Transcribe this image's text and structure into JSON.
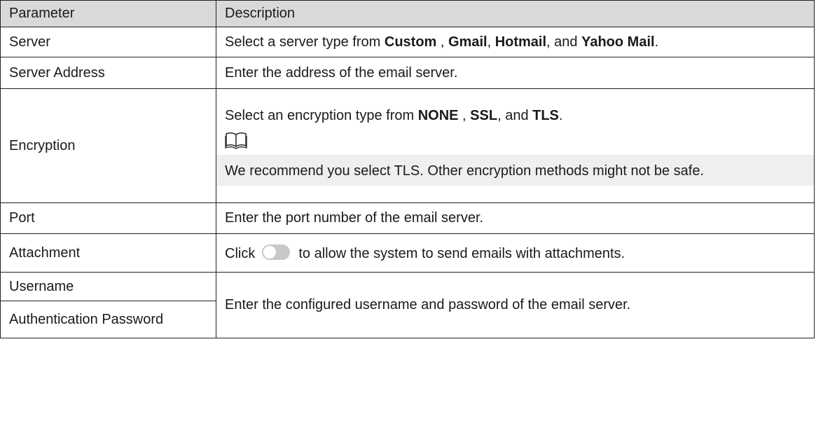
{
  "table": {
    "headers": [
      "Parameter",
      "Description"
    ],
    "server": {
      "param": "Server",
      "desc_prefix": "Select a server type from ",
      "opt1": "Custom",
      "sep1": " , ",
      "opt2": "Gmail",
      "sep2": ", ",
      "opt3": "Hotmail",
      "sep3": ", and ",
      "opt4": "Yahoo Mail",
      "end": "."
    },
    "server_address": {
      "param": "Server Address",
      "desc": "Enter the address of the email server."
    },
    "encryption": {
      "param": "Encryption",
      "desc_prefix": "Select an encryption type from ",
      "opt1": "NONE",
      "sep1": " , ",
      "opt2": "SSL",
      "sep2": ", and ",
      "opt3": "TLS",
      "end": ".",
      "note_icon": "book-note-icon",
      "note": "We recommend you select TLS. Other encryption methods might not be safe."
    },
    "port": {
      "param": "Port",
      "desc": "Enter the port number of the email server."
    },
    "attachment": {
      "param": "Attachment",
      "desc_prefix": "Click",
      "toggle_icon": "toggle-switch-off-icon",
      "desc_suffix": "to allow the system to send emails with attachments."
    },
    "username": {
      "param": "Username"
    },
    "auth_password": {
      "param": "Authentication Password"
    },
    "credentials_desc": "Enter the configured username and password of the email server."
  }
}
